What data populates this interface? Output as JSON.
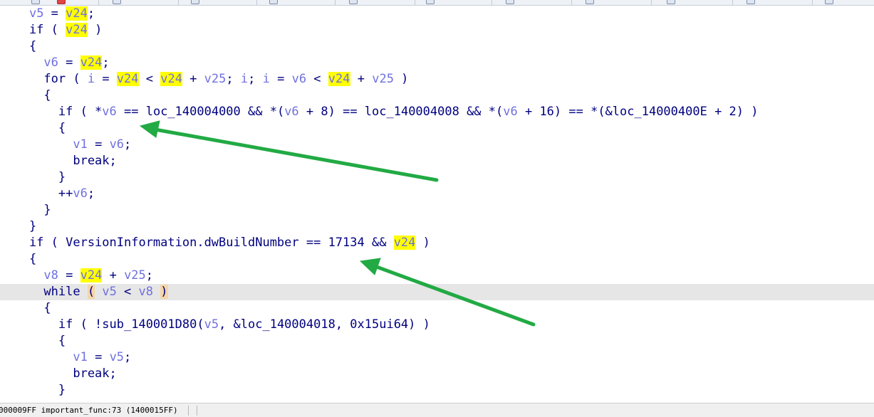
{
  "code_lines": [
    {
      "current": false,
      "tokens": [
        {
          "t": "    "
        },
        {
          "t": "v5",
          "c": "var"
        },
        {
          "t": " = "
        },
        {
          "t": "v24",
          "c": "var",
          "hl": true
        },
        {
          "t": ";"
        }
      ]
    },
    {
      "current": false,
      "tokens": [
        {
          "t": "    if ( "
        },
        {
          "t": "v24",
          "c": "var",
          "hl": true
        },
        {
          "t": " )"
        }
      ]
    },
    {
      "current": false,
      "tokens": [
        {
          "t": "    {"
        }
      ]
    },
    {
      "current": false,
      "tokens": [
        {
          "t": "      "
        },
        {
          "t": "v6",
          "c": "var"
        },
        {
          "t": " = "
        },
        {
          "t": "v24",
          "c": "var",
          "hl": true
        },
        {
          "t": ";"
        }
      ]
    },
    {
      "current": false,
      "tokens": [
        {
          "t": "      for ( "
        },
        {
          "t": "i",
          "c": "var"
        },
        {
          "t": " = "
        },
        {
          "t": "v24",
          "c": "var",
          "hl": true
        },
        {
          "t": " < "
        },
        {
          "t": "v24",
          "c": "var",
          "hl": true
        },
        {
          "t": " + "
        },
        {
          "t": "v25",
          "c": "var"
        },
        {
          "t": "; "
        },
        {
          "t": "i",
          "c": "var"
        },
        {
          "t": "; "
        },
        {
          "t": "i",
          "c": "var"
        },
        {
          "t": " = "
        },
        {
          "t": "v6",
          "c": "var"
        },
        {
          "t": " < "
        },
        {
          "t": "v24",
          "c": "var",
          "hl": true
        },
        {
          "t": " + "
        },
        {
          "t": "v25",
          "c": "var"
        },
        {
          "t": " )"
        }
      ]
    },
    {
      "current": false,
      "tokens": [
        {
          "t": "      {"
        }
      ]
    },
    {
      "current": false,
      "tokens": [
        {
          "t": "        if ( *"
        },
        {
          "t": "v6",
          "c": "var"
        },
        {
          "t": " == loc_140004000 && *("
        },
        {
          "t": "v6",
          "c": "var"
        },
        {
          "t": " + 8) == loc_140004008 && *("
        },
        {
          "t": "v6",
          "c": "var"
        },
        {
          "t": " + 16) == *(&loc_14000400E + 2) )"
        }
      ]
    },
    {
      "current": false,
      "tokens": [
        {
          "t": "        {"
        }
      ]
    },
    {
      "current": false,
      "tokens": [
        {
          "t": "          "
        },
        {
          "t": "v1",
          "c": "var"
        },
        {
          "t": " = "
        },
        {
          "t": "v6",
          "c": "var"
        },
        {
          "t": ";"
        }
      ]
    },
    {
      "current": false,
      "tokens": [
        {
          "t": "          break;"
        }
      ]
    },
    {
      "current": false,
      "tokens": [
        {
          "t": "        }"
        }
      ]
    },
    {
      "current": false,
      "tokens": [
        {
          "t": "        ++"
        },
        {
          "t": "v6",
          "c": "var"
        },
        {
          "t": ";"
        }
      ]
    },
    {
      "current": false,
      "tokens": [
        {
          "t": "      }"
        }
      ]
    },
    {
      "current": false,
      "tokens": [
        {
          "t": "    }"
        }
      ]
    },
    {
      "current": false,
      "tokens": [
        {
          "t": "    if ( VersionInformation.dwBuildNumber == 17134 && "
        },
        {
          "t": "v24",
          "c": "var",
          "hl": true
        },
        {
          "t": " )"
        }
      ]
    },
    {
      "current": false,
      "tokens": [
        {
          "t": "    {"
        }
      ]
    },
    {
      "current": false,
      "tokens": [
        {
          "t": "      "
        },
        {
          "t": "v8",
          "c": "var"
        },
        {
          "t": " = "
        },
        {
          "t": "v24",
          "c": "var",
          "hl": true
        },
        {
          "t": " + "
        },
        {
          "t": "v25",
          "c": "var"
        },
        {
          "t": ";"
        }
      ]
    },
    {
      "current": true,
      "tokens": [
        {
          "t": "      while "
        },
        {
          "t": "(",
          "paren": true
        },
        {
          "t": " "
        },
        {
          "t": "v5",
          "c": "var"
        },
        {
          "t": " < "
        },
        {
          "t": "v8",
          "c": "var"
        },
        {
          "t": " "
        },
        {
          "t": ")",
          "paren": true
        }
      ]
    },
    {
      "current": false,
      "tokens": [
        {
          "t": "      {"
        }
      ]
    },
    {
      "current": false,
      "tokens": [
        {
          "t": "        if ( !sub_140001D80("
        },
        {
          "t": "v5",
          "c": "var"
        },
        {
          "t": ", &loc_140004018, 0x15ui64) )"
        }
      ]
    },
    {
      "current": false,
      "tokens": [
        {
          "t": "        {"
        }
      ]
    },
    {
      "current": false,
      "tokens": [
        {
          "t": "          "
        },
        {
          "t": "v1",
          "c": "var"
        },
        {
          "t": " = "
        },
        {
          "t": "v5",
          "c": "var"
        },
        {
          "t": ";"
        }
      ]
    },
    {
      "current": false,
      "tokens": [
        {
          "t": "          break;"
        }
      ]
    },
    {
      "current": false,
      "tokens": [
        {
          "t": "        }"
        }
      ]
    }
  ],
  "status_bar": {
    "location": "000009FF important_func:73 (1400015FF)"
  },
  "colors": {
    "highlight": "#ffff00",
    "variable": "#7070e0",
    "code_text": "#000080",
    "current_line": "#e6e6e6",
    "paren_match": "#f4d6a8",
    "arrow": "#22aa44"
  },
  "annotations": [
    {
      "name": "arrow-to-v6-comparison"
    },
    {
      "name": "arrow-to-build-number-check"
    }
  ]
}
